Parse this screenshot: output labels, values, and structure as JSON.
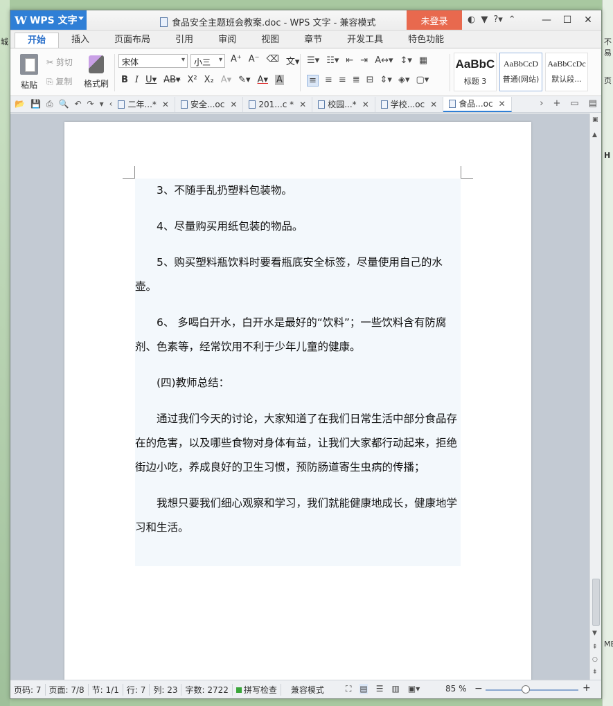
{
  "app": {
    "brand": "WPS 文字",
    "title": "食品安全主题班会教案.doc - WPS 文字 - 兼容模式",
    "login": "未登录"
  },
  "ribbon_tabs": [
    "开始",
    "插入",
    "页面布局",
    "引用",
    "审阅",
    "视图",
    "章节",
    "开发工具",
    "特色功能"
  ],
  "clipboard": {
    "paste": "粘贴",
    "cut": "剪切",
    "copy": "复制",
    "format_painter": "格式刷"
  },
  "font": {
    "family": "宋体",
    "size": "小三"
  },
  "styles": [
    {
      "preview": "AaBbC",
      "label": "标题 3"
    },
    {
      "preview": "AaBbCcD",
      "label": "普通(网站)"
    },
    {
      "preview": "AaBbCcDc",
      "label": "默认段..."
    }
  ],
  "doc_tabs": [
    {
      "label": "二年...*"
    },
    {
      "label": "安全...oc"
    },
    {
      "label": "201...c *"
    },
    {
      "label": "校园...*"
    },
    {
      "label": "学校...oc"
    },
    {
      "label": "食品...oc"
    }
  ],
  "document": {
    "paragraphs": [
      "3、不随手乱扔塑料包装物。",
      "4、尽量购买用纸包装的物品。",
      "5、购买塑料瓶饮料时要看瓶底安全标签，尽量使用自己的水壶。",
      "6、 多喝白开水，白开水是最好的“饮料”；一些饮料含有防腐剂、色素等，经常饮用不利于少年儿童的健康。",
      "(四)教师总结：",
      "通过我们今天的讨论，大家知道了在我们日常生活中部分食品存在的危害，以及哪些食物对身体有益，让我们大家都行动起来，拒绝街边小吃，养成良好的卫生习惯，预防肠道寄生虫病的传播；",
      "我想只要我们细心观察和学习，我们就能健康地成长，健康地学习和生活。"
    ]
  },
  "status": {
    "page_code": "页码: 7",
    "pages": "页面: 7/8",
    "section": "节: 1/1",
    "row": "行: 7",
    "col": "列: 23",
    "words": "字数: 2722",
    "spell": "拼写检查",
    "mode": "兼容模式",
    "zoom": "85 %"
  },
  "side_peek": {
    "left_top": "城",
    "right_top": "不易",
    "right_mid": "页",
    "right_mid2": "H",
    "right_bottom": "ME"
  }
}
